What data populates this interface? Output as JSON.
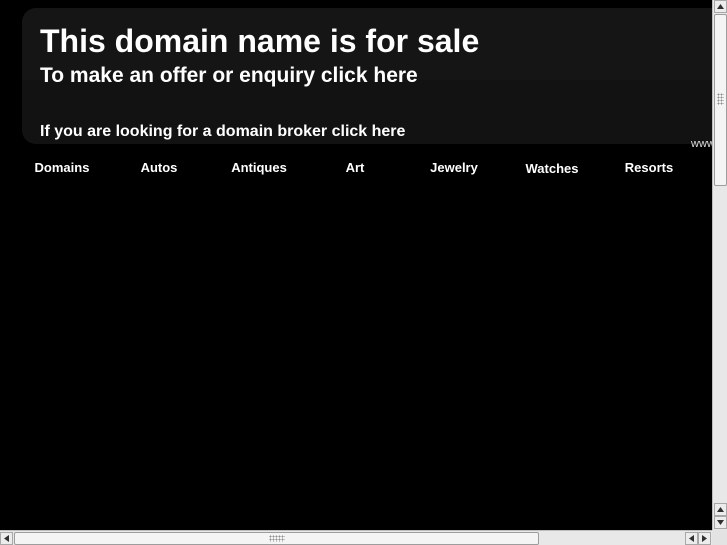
{
  "page": {
    "title": "This domain name is for sale",
    "offer_link": "To make an offer or enquiry click here",
    "broker_link": "If you are looking for a domain broker click here",
    "cut_text": "www"
  },
  "nav": {
    "items": [
      {
        "label": "Domains"
      },
      {
        "label": "Autos"
      },
      {
        "label": "Antiques"
      },
      {
        "label": "Art"
      },
      {
        "label": "Jewelry"
      },
      {
        "label": "Watches"
      },
      {
        "label": "Resorts"
      }
    ]
  },
  "scrollbars": {
    "vertical_icons": [
      "arrow-up-icon",
      "arrow-down-icon"
    ],
    "horizontal_icons": [
      "arrow-left-icon",
      "arrow-right-icon"
    ]
  },
  "colors": {
    "background": "#000000",
    "banner": "#151515",
    "text": "#ffffff",
    "scrollbar_track": "#e8e8e8"
  }
}
